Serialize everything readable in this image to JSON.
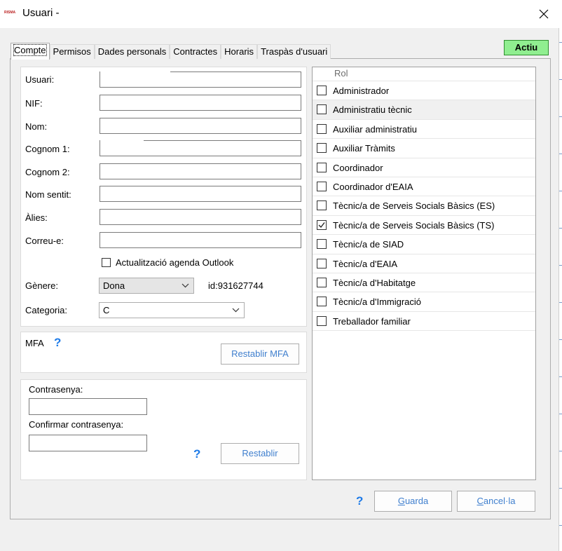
{
  "window": {
    "logo_text": "RISMA",
    "title": "Usuari -"
  },
  "tabs": [
    {
      "label": "Compte"
    },
    {
      "label": "Permisos"
    },
    {
      "label": "Dades personals"
    },
    {
      "label": "Contractes"
    },
    {
      "label": "Horaris"
    },
    {
      "label": "Traspàs d'usuari"
    }
  ],
  "status": {
    "label": "Actiu",
    "color": "#90ee90"
  },
  "form": {
    "usuari_label": "Usuari:",
    "nif_label": "NIF:",
    "nom_label": "Nom:",
    "cognom1_label": "Cognom 1:",
    "cognom2_label": "Cognom 2:",
    "nom_sentit_label": "Nom sentit:",
    "alies_label": "Àlies:",
    "correu_label": "Correu-e:",
    "outlook_label": "Actualització agenda Outlook",
    "genere_label": "Gènere:",
    "genere_value": "Dona",
    "id_text": "id:931627744",
    "categoria_label": "Categoria:",
    "categoria_value": "C"
  },
  "mfa": {
    "label": "MFA",
    "help": "?",
    "reset_button": "Restablir MFA"
  },
  "password": {
    "contrasenya_label": "Contrasenya:",
    "confirm_label": "Confirmar contrasenya:",
    "help": "?",
    "reset_button": "Restablir"
  },
  "roles": {
    "header": "Rol",
    "items": [
      {
        "label": "Administrador",
        "checked": false
      },
      {
        "label": "Administratiu tècnic",
        "checked": false
      },
      {
        "label": "Auxiliar administratiu",
        "checked": false
      },
      {
        "label": "Auxiliar Tràmits",
        "checked": false
      },
      {
        "label": "Coordinador",
        "checked": false
      },
      {
        "label": "Coordinador d'EAIA",
        "checked": false
      },
      {
        "label": "Tècnic/a de Serveis Socials Bàsics (ES)",
        "checked": false
      },
      {
        "label": "Tècnic/a de Serveis Socials Bàsics (TS)",
        "checked": true
      },
      {
        "label": "Tècnic/a de SIAD",
        "checked": false
      },
      {
        "label": "Tècnic/a d'EAIA",
        "checked": false
      },
      {
        "label": "Tècnic/a d'Habitatge",
        "checked": false
      },
      {
        "label": "Tècnic/a d'Immigració",
        "checked": false
      },
      {
        "label": "Treballador familiar",
        "checked": false
      }
    ]
  },
  "footer": {
    "help": "?",
    "save_prefix": "G",
    "save_rest": "uarda",
    "cancel_prefix": "C",
    "cancel_rest": "ancel·la"
  },
  "colors": {
    "accent": "#1e7be8",
    "button_text": "#3f7fce"
  }
}
